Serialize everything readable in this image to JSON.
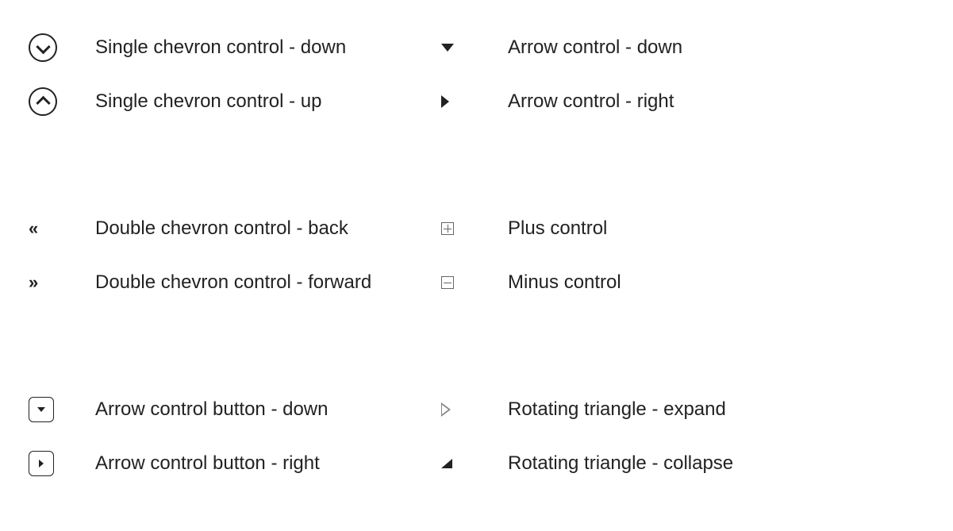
{
  "items": {
    "single_chevron_down": "Single chevron control - down",
    "single_chevron_up": "Single chevron control - up",
    "arrow_control_down": "Arrow control - down",
    "arrow_control_right": "Arrow control - right",
    "double_chevron_back": "Double chevron control - back",
    "double_chevron_forward": "Double chevron control - forward",
    "plus_control": "Plus control",
    "minus_control": "Minus control",
    "arrow_button_down": "Arrow control button - down",
    "arrow_button_right": "Arrow control button - right",
    "rotating_triangle_expand": "Rotating triangle - expand",
    "rotating_triangle_collapse": "Rotating triangle - collapse"
  }
}
